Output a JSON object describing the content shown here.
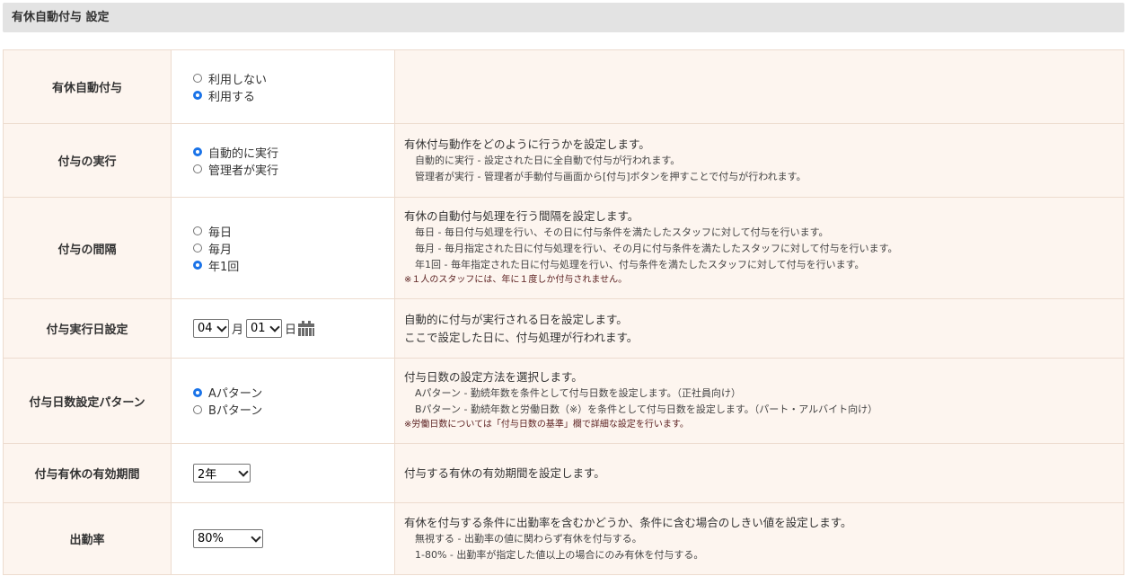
{
  "header": {
    "title": "有休自動付与 設定"
  },
  "rows": {
    "auto_grant": {
      "label": "有休自動付与",
      "options": [
        "利用しない",
        "利用する"
      ],
      "selected": 1
    },
    "execution": {
      "label": "付与の実行",
      "options": [
        "自動的に実行",
        "管理者が実行"
      ],
      "selected": 0,
      "desc_main": "有休付与動作をどのように行うかを設定します。",
      "desc_sub": [
        "自動的に実行 - 設定された日に全自動で付与が行われます。",
        "管理者が実行 - 管理者が手動付与画面から[付与]ボタンを押すことで付与が行われます。"
      ]
    },
    "interval": {
      "label": "付与の間隔",
      "options": [
        "毎日",
        "毎月",
        "年1回"
      ],
      "selected": 2,
      "desc_main": "有休の自動付与処理を行う間隔を設定します。",
      "desc_sub": [
        "毎日 - 毎日付与処理を行い、その日に付与条件を満たしたスタッフに対して付与を行います。",
        "毎月 - 毎月指定された日に付与処理を行い、その月に付与条件を満たしたスタッフに対して付与を行います。",
        "年1回 - 毎年指定された日に付与処理を行い、付与条件を満たしたスタッフに対して付与を行います。"
      ],
      "note": "※１人のスタッフには、年に１度しか付与されません。"
    },
    "exec_date": {
      "label": "付与実行日設定",
      "month_value": "04",
      "month_unit": "月",
      "day_value": "01",
      "day_unit": "日",
      "desc_lines": [
        "自動的に付与が実行される日を設定します。",
        "ここで設定した日に、付与処理が行われます。"
      ]
    },
    "days_pattern": {
      "label": "付与日数設定パターン",
      "options": [
        "Aパターン",
        "Bパターン"
      ],
      "selected": 0,
      "desc_main": "付与日数の設定方法を選択します。",
      "desc_sub": [
        "Aパターン - 勤続年数を条件として付与日数を設定します。（正社員向け）",
        "Bパターン - 勤続年数と労働日数（※）を条件として付与日数を設定します。（パート・アルバイト向け）"
      ],
      "note": "※労働日数については「付与日数の基準」欄で詳細な設定を行います。"
    },
    "validity": {
      "label": "付与有休の有効期間",
      "select_value": "2年",
      "desc_main": "付与する有休の有効期間を設定します。"
    },
    "attendance": {
      "label": "出勤率",
      "select_value": "80%",
      "desc_main": "有休を付与する条件に出勤率を含むかどうか、条件に含む場合のしきい値を設定します。",
      "desc_sub": [
        "無視する - 出勤率の値に関わらず有休を付与する。",
        "1-80% - 出勤率が指定した値以上の場合にのみ有休を付与する。"
      ]
    }
  }
}
